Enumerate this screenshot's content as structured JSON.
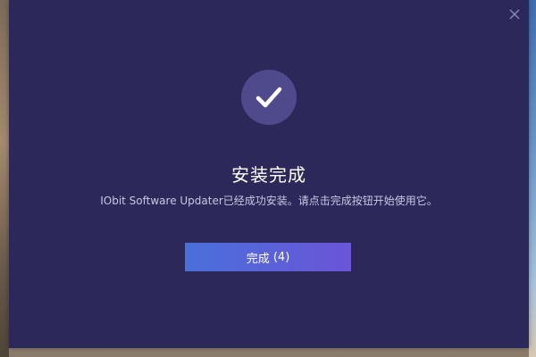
{
  "dialog": {
    "title": "安装完成",
    "message": "IObit Software Updater已经成功安装。请点击完成按钮开始使用它。",
    "finish_button": {
      "label": "完成",
      "countdown": "(4)"
    }
  },
  "icons": {
    "close": "close-icon",
    "success": "checkmark-icon"
  },
  "colors": {
    "dialog_background": "#2c285a",
    "icon_circle": "#4f4a8b",
    "button_gradient_start": "#4b6fda",
    "button_gradient_end": "#6a55d8",
    "title_text": "#ffffff",
    "message_text": "#c9c6e6"
  }
}
